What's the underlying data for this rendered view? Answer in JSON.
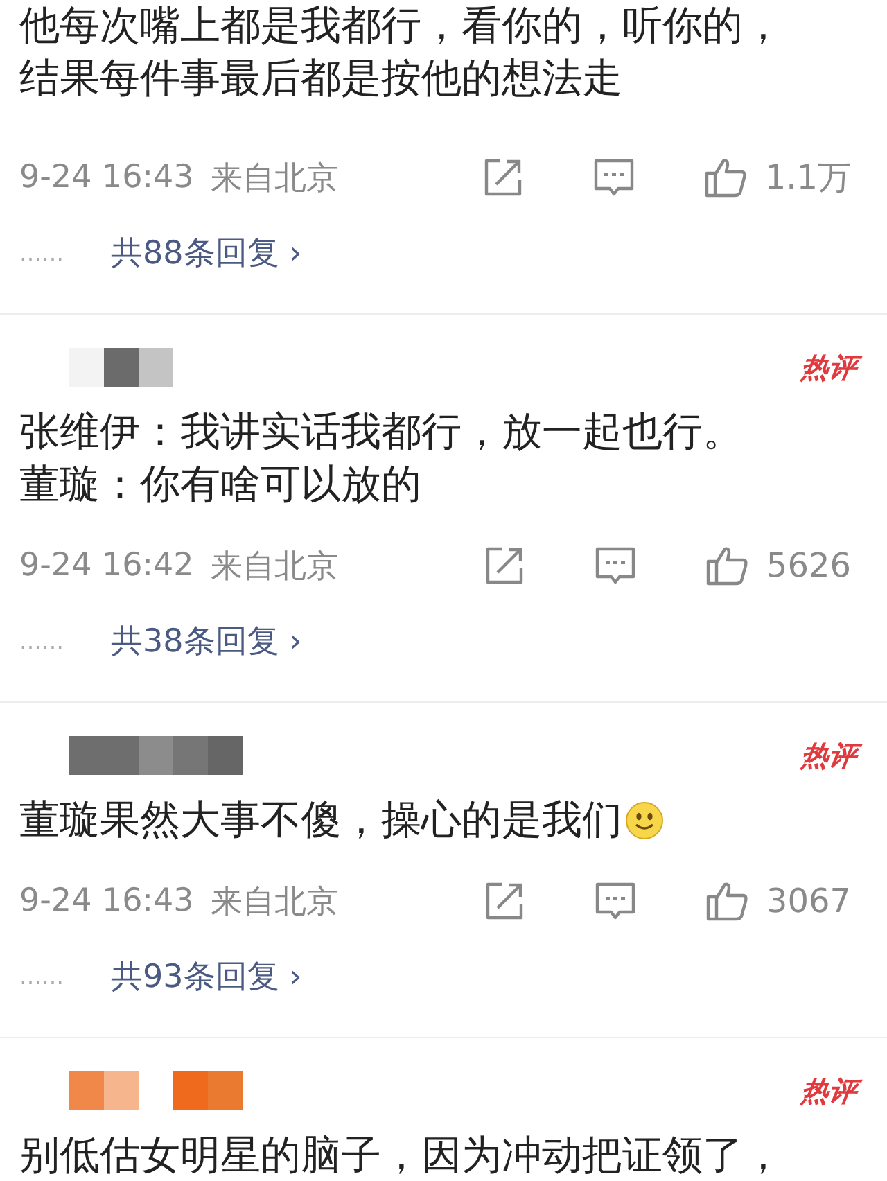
{
  "comments": [
    {
      "lines": [
        "他每次嘴上都是我都行，看你的，听你的，",
        "结果每件事最后都是按他的想法走"
      ],
      "time": "9-24 16:43",
      "location": "来自北京",
      "likes": "1.1万",
      "replies_ellipsis": "……",
      "replies": "共88条回复 ›"
    },
    {
      "mosaic": [
        {
          "color": "#f3f3f3"
        },
        {
          "color": "#6b6b6b"
        },
        {
          "color": "#c4c4c4"
        }
      ],
      "badge": "热评",
      "lines": [
        "张维伊：我讲实话我都行，放一起也行。",
        "董璇：你有啥可以放的"
      ],
      "time": "9-24 16:42",
      "location": "来自北京",
      "likes": "5626",
      "replies_ellipsis": "……",
      "replies": "共38条回复 ›"
    },
    {
      "mosaic": [
        {
          "color": "#6e6e6e"
        },
        {
          "color": "#6e6e6e"
        },
        {
          "color": "#8c8c8c"
        },
        {
          "color": "#767676"
        },
        {
          "color": "#666666"
        }
      ],
      "badge": "热评",
      "lines": [
        "董璇果然大事不傻，操心的是我们"
      ],
      "emoji": {
        "kind": "smile"
      },
      "time": "9-24 16:43",
      "location": "来自北京",
      "likes": "3067",
      "replies_ellipsis": "……",
      "replies": "共93条回复 ›"
    },
    {
      "mosaic": [
        {
          "color": "#f0884a"
        },
        {
          "color": "#f6b58c"
        },
        {
          "color": "#ffffff"
        },
        {
          "color": "#f06a1e"
        },
        {
          "color": "#ea7a30"
        }
      ],
      "badge": "热评",
      "lines": [
        "别低估女明星的脑子，因为冲动把证领了，"
      ]
    }
  ]
}
